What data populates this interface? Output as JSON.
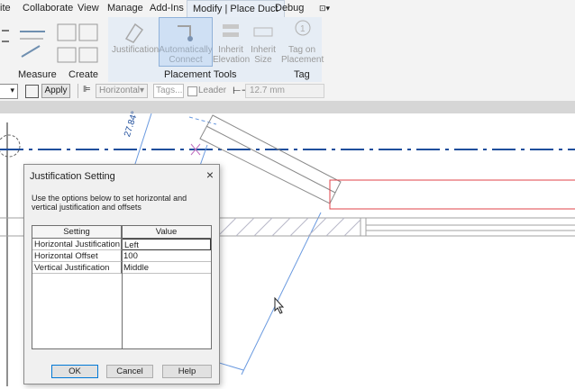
{
  "menubar": {
    "items": [
      "ite",
      "Collaborate",
      "View",
      "Manage",
      "Add-Ins",
      "Modify | Place Duct",
      "Debug"
    ]
  },
  "ribbon": {
    "panels": [
      "Measure",
      "Create",
      "Placement Tools",
      "Tag"
    ],
    "buttons": {
      "justification": "Justification",
      "auto_connect_1": "Automatically",
      "auto_connect_2": "Connect",
      "inherit_elev_1": "Inherit",
      "inherit_elev_2": "Elevation",
      "inherit_size_1": "Inherit",
      "inherit_size_2": "Size",
      "tag_on_1": "Tag on",
      "tag_on_2": "Placement"
    }
  },
  "options_bar": {
    "apply": "Apply",
    "orientation": "Horizontal",
    "tags_placeholder": "Tags...",
    "leader": "Leader",
    "offset": "12.7 mm"
  },
  "canvas": {
    "angle_label": "27.84°"
  },
  "dialog": {
    "title": "Justification Setting",
    "close": "×",
    "description": "Use the options below to set horizontal and vertical justification and offsets",
    "columns": [
      "Setting",
      "Value"
    ],
    "rows": [
      {
        "setting": "Horizontal Justification",
        "value": "Left"
      },
      {
        "setting": "Horizontal Offset",
        "value": "100"
      },
      {
        "setting": "Vertical Justification",
        "value": "Middle"
      }
    ],
    "ok": "OK",
    "cancel": "Cancel",
    "help": "Help"
  },
  "colors": {
    "accent": "#0078d7",
    "duct_red": "#e0434a",
    "centerline": "#1f4e9c",
    "context_tab": "#e6edf5"
  }
}
